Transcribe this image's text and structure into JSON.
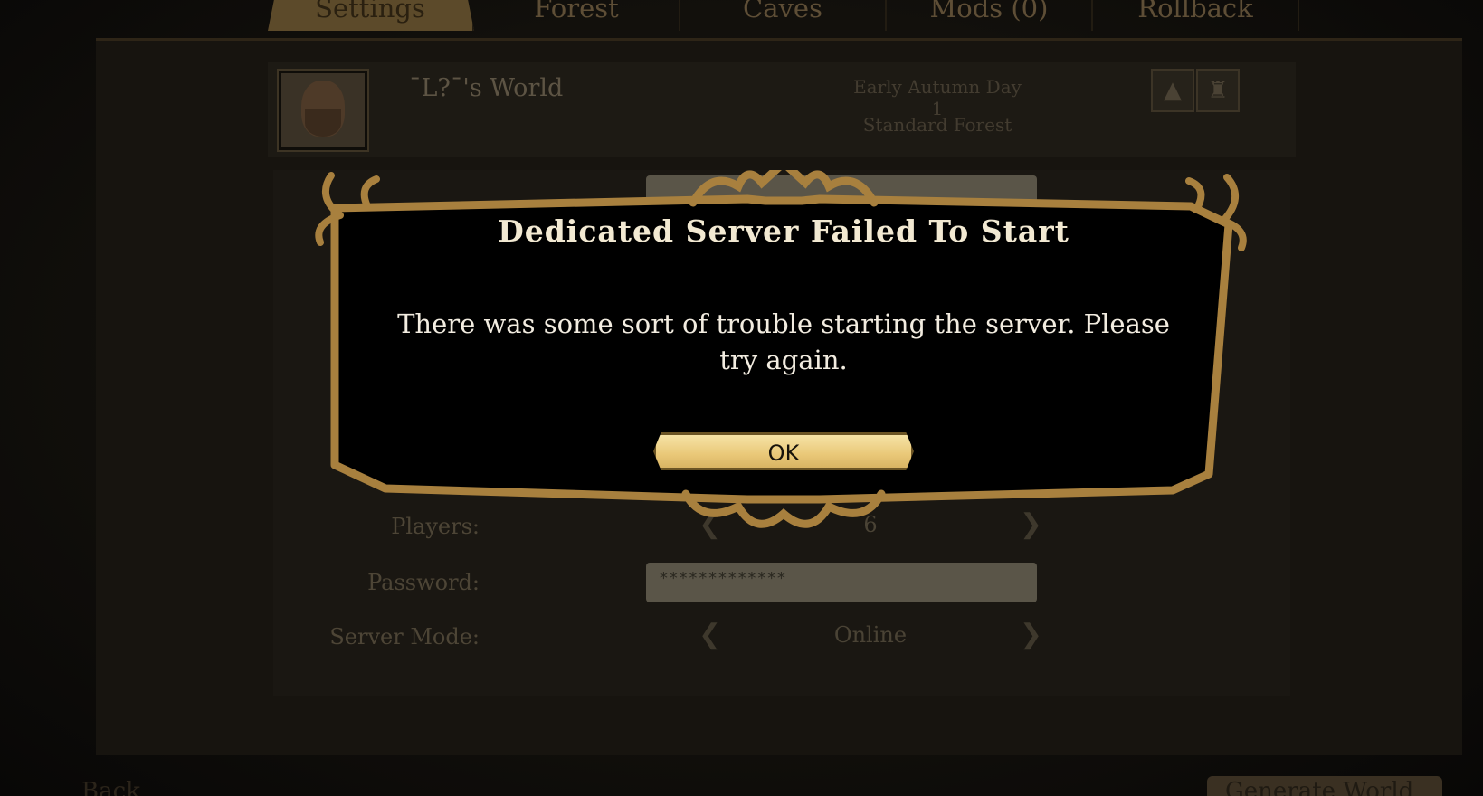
{
  "tabs": [
    {
      "label": "Settings",
      "active": true
    },
    {
      "label": "Forest",
      "active": false
    },
    {
      "label": "Caves",
      "active": false
    },
    {
      "label": "Mods (0)",
      "active": false
    },
    {
      "label": "Rollback",
      "active": false
    }
  ],
  "world": {
    "name": "¯L?¯'s World",
    "season": "Early Autumn Day 1",
    "preset": "Standard Forest"
  },
  "settings": {
    "players_label": "Players:",
    "players_value": "6",
    "password_label": "Password:",
    "password_value": "*************",
    "server_mode_label": "Server Mode:",
    "server_mode_value": "Online"
  },
  "bottom": {
    "back_label": "Back",
    "generate_label": "Generate World"
  },
  "dialog": {
    "title": "Dedicated Server Failed To Start",
    "message": "There was some sort of trouble starting the server. Please try again.",
    "ok_label": "OK"
  },
  "colors": {
    "dialog_bg": "#000000",
    "frame_gold": "#a8803e",
    "ok_button": "#eccf82"
  }
}
